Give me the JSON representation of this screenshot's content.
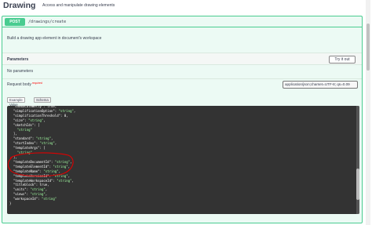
{
  "header": {
    "title": "Drawing",
    "description": "Access and manipulate drawing elements"
  },
  "operation": {
    "method": "POST",
    "path": "/drawings/create",
    "summary": "Build a drawing app element in document's workspace"
  },
  "parameters": {
    "section_label": "Parameters",
    "try_button": "Try it out",
    "empty_text": "No parameters"
  },
  "request_body": {
    "label": "Request body",
    "required_marker": "required",
    "content_type": "application/json;charset=UTF-8; qs=0.09",
    "tabs": [
      "Example Value",
      "Schema"
    ]
  },
  "code_lines": [
    "  \"showScaleWelly\": true,",
    "  \"simplificationOption\": \"string\",",
    "  \"simplificationThreshold\": 0,",
    "  \"size\": \"string\",",
    "  \"sketchIds\": [",
    "    \"string\"",
    "  ],",
    "  \"standard\": \"string\",",
    "  \"startIndex\": \"string\",",
    "  \"templateArgs\": [",
    "    \"string\"",
    "  ],",
    "  \"templateDocumentId\": \"string\",",
    "  \"templateElementId\": \"string\",",
    "  \"templateName\": \"string\",",
    "  \"templateVersionId\": \"string\",",
    "  \"templateWorkspaceId\": \"string\",",
    "  \"titleblock\": true,",
    "  \"units\": \"string\",",
    "  \"views\": \"string\",",
    "  \"workspaceId\": \"string\"",
    "}"
  ],
  "colors": {
    "post": "#49cc90",
    "code_bg": "#333333",
    "string": "#a2fca2",
    "annotation": "#e00000"
  }
}
